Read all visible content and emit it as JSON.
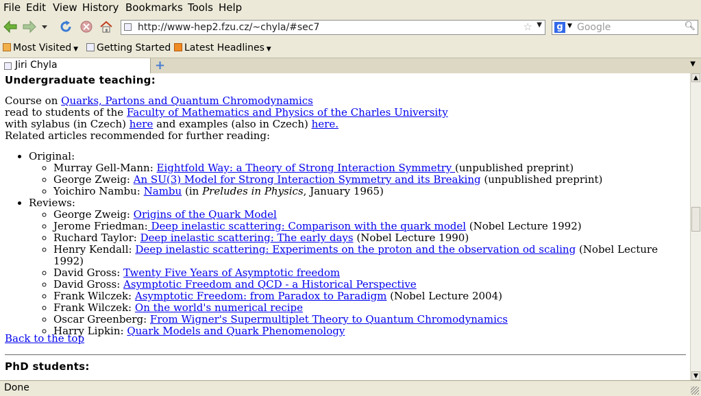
{
  "menu": [
    "File",
    "Edit",
    "View",
    "History",
    "Bookmarks",
    "Tools",
    "Help"
  ],
  "nav": {
    "url": "http://www-hep2.fzu.cz/~chyla/#sec7",
    "search_placeholder": "Google",
    "search_engine_icon": "google-icon"
  },
  "bookmarks": [
    {
      "label": "Most Visited",
      "icon": "folder-icon",
      "dropdown": true
    },
    {
      "label": "Getting Started",
      "icon": "page-icon",
      "dropdown": false
    },
    {
      "label": "Latest Headlines",
      "icon": "rss-icon",
      "dropdown": true
    }
  ],
  "tab": {
    "title": "Jiri Chyla"
  },
  "status": "Done",
  "content": {
    "heading": "Undergraduate teaching:",
    "course_prefix": "Course on ",
    "course_link": "Quarks, Partons and Quantum Chromodynamics",
    "read_prefix": "read to students of the ",
    "faculty_link": "Faculty of Mathematics and Physics of the Charles University",
    "syl_prefix": "with sylabus (in Czech) ",
    "here1": "here",
    "syl_mid": " and examples (also in Czech) ",
    "here2": "here.",
    "related": "Related articles recommended for further reading:",
    "original_label": "Original:",
    "original": [
      {
        "pre": "Murray Gell-Mann: ",
        "link": "Eightfold Way: a Theory of Strong Interaction Symmetry ",
        "post": "(unpublished preprint)"
      },
      {
        "pre": "George Zweig: ",
        "link": "An SU(3) Model for Strong Interaction Symmetry and its Breaking",
        "post": " (unpublished preprint)"
      },
      {
        "pre": "Yoichiro Nambu: ",
        "link": "Nambu",
        "post_a": " (in ",
        "italic": "Preludes in Physics",
        "post": ", January 1965)"
      }
    ],
    "reviews_label": "Reviews:",
    "reviews": [
      {
        "pre": "George Zweig: ",
        "link": "Origins of the Quark Model",
        "post": ""
      },
      {
        "pre": "Jerome Friedman:",
        "link": " Deep inelastic scattering: Comparison with the quark model",
        "post": " (Nobel Lecture 1992)"
      },
      {
        "pre": "Ruchard Taylor: ",
        "link": "Deep inelastic scattering: The early days",
        "post": " (Nobel Lecture 1990)"
      },
      {
        "pre": "Henry Kendall: ",
        "link": "Deep inelastic scattering: Experiments on the proton and the observation od scaling",
        "post": " (Nobel Lecture 1992)"
      },
      {
        "pre": "David Gross: ",
        "link": "Twenty Five Years of Asymptotic freedom",
        "post": ""
      },
      {
        "pre": "David Gross: ",
        "link": "Asymptotic Freedom and QCD - a Historical Perspective",
        "post": ""
      },
      {
        "pre": "Frank Wilczek: ",
        "link": "Asymptotic Freedom: from Paradox to Paradigm",
        "post": " (Nobel Lecture 2004)"
      },
      {
        "pre": "Frank Wilczek: ",
        "link": "On the world's numerical recipe",
        "post": ""
      },
      {
        "pre": "Oscar Greenberg: ",
        "link": "From Wigner's Supermultiplet Theory to Quantum Chromodynamics",
        "post": ""
      },
      {
        "pre": "Harry Lipkin: ",
        "link": "Quark Models and Quark Phenomenology",
        "post": ""
      }
    ],
    "back_to_top": "Back to the top",
    "phd_heading": "PhD students:"
  }
}
